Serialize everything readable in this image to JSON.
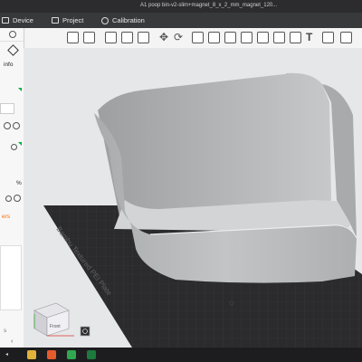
{
  "window": {
    "title": "A1 poop bin-v2-slim+magnet_8_x_2_mm_magnet_120..."
  },
  "nav": {
    "device": "Device",
    "project": "Project",
    "calibration": "Calibration"
  },
  "sidebar": {
    "info_label": "info",
    "percent_label": "%",
    "orange_text": "ers"
  },
  "plate": {
    "label": "Bambu Textured PEI Plate"
  },
  "view_cube": {
    "front_label": "Front"
  },
  "colors": {
    "accent": "#00ae42",
    "orange": "#ff6a00",
    "model": "#b9bbbd",
    "plate": "#2b2b2d"
  }
}
